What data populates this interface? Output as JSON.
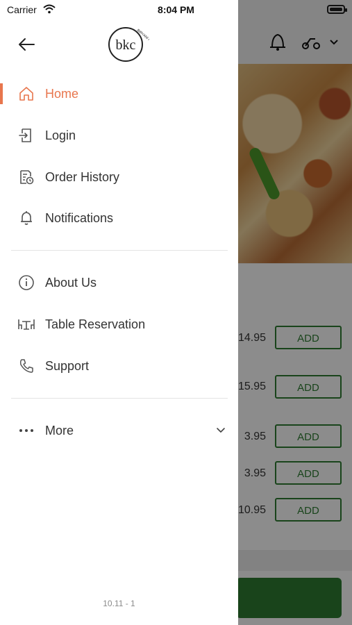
{
  "status_bar": {
    "carrier": "Carrier",
    "time": "8:04 PM"
  },
  "drawer": {
    "logo_text": "bkc",
    "logo_ring_text": "BIRYANI KEBAB CHAI",
    "items": [
      {
        "label": "Home",
        "icon": "home-icon",
        "active": true
      },
      {
        "label": "Login",
        "icon": "login-icon"
      },
      {
        "label": "Order History",
        "icon": "order-history-icon"
      },
      {
        "label": "Notifications",
        "icon": "bell-icon"
      },
      {
        "label": "About Us",
        "icon": "info-icon"
      },
      {
        "label": "Table Reservation",
        "icon": "table-icon"
      },
      {
        "label": "Support",
        "icon": "phone-icon"
      },
      {
        "label": "More",
        "icon": "more-icon"
      }
    ],
    "version": "10.11 - 1"
  },
  "background": {
    "prices": [
      "14.95",
      "15.95",
      "3.95",
      "3.95",
      "10.95"
    ],
    "add_label": "ADD"
  },
  "colors": {
    "accent": "#e8764d",
    "brand_green": "#2e7d32"
  }
}
